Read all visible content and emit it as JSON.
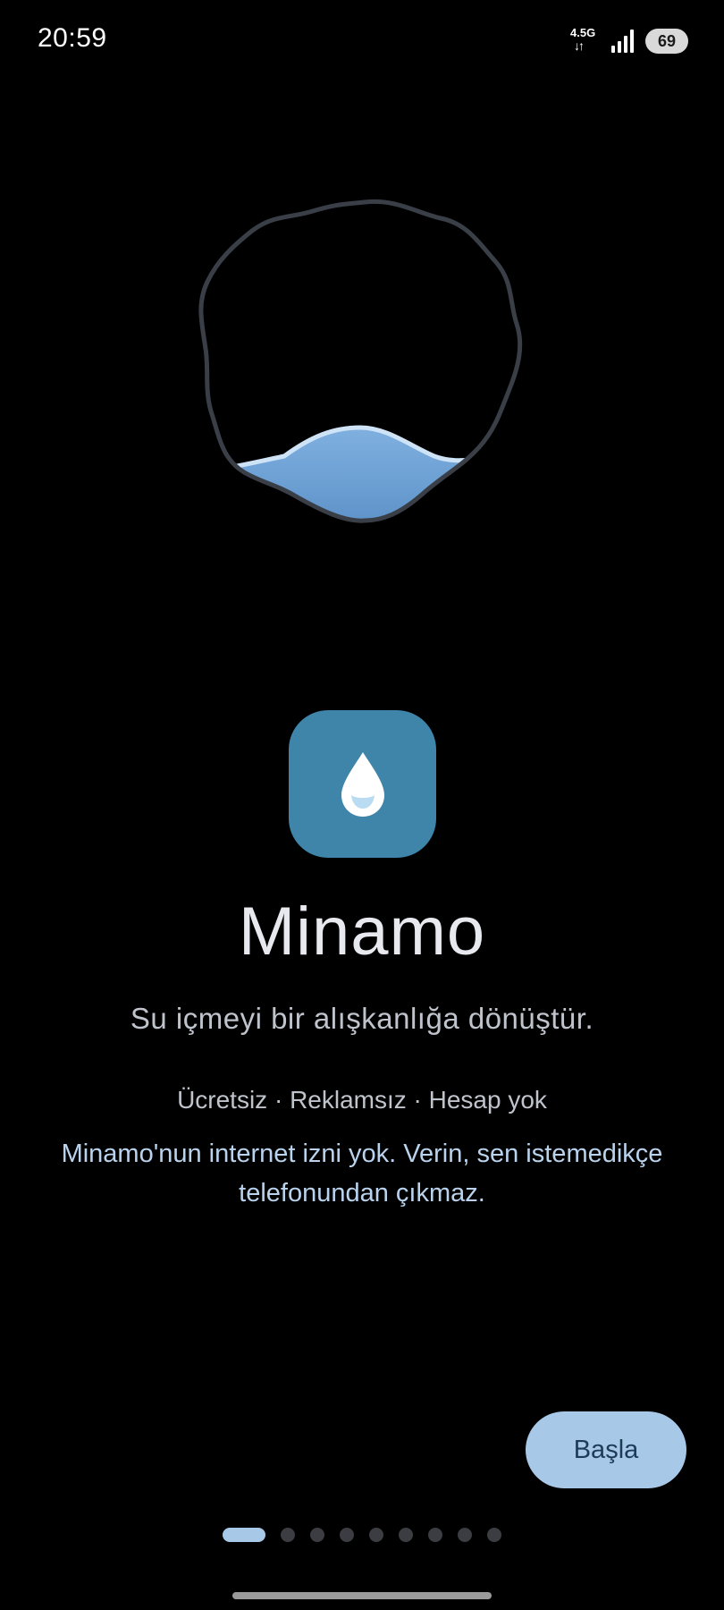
{
  "status_bar": {
    "time": "20:59",
    "network": "4.5G",
    "network_arrows": "↓↑",
    "battery": "69"
  },
  "app": {
    "name": "Minamo",
    "tagline": "Su içmeyi bir alışkanlığa dönüştür.",
    "features": "Ücretsiz · Reklamsız · Hesap yok",
    "privacy_note": "Minamo'nun internet izni yok. Verin, sen istemedikçe telefonundan çıkmaz."
  },
  "actions": {
    "start_label": "Başla"
  },
  "onboarding": {
    "total_pages": 9,
    "current_page": 1
  },
  "colors": {
    "background": "#000000",
    "accent": "#a8c8e8",
    "app_icon": "#3e85a9",
    "water": "#6a9ed2",
    "ring": "#3a3f47"
  },
  "icons": {
    "app_icon": "water-drop-icon",
    "illustration": "water-level-ring"
  }
}
